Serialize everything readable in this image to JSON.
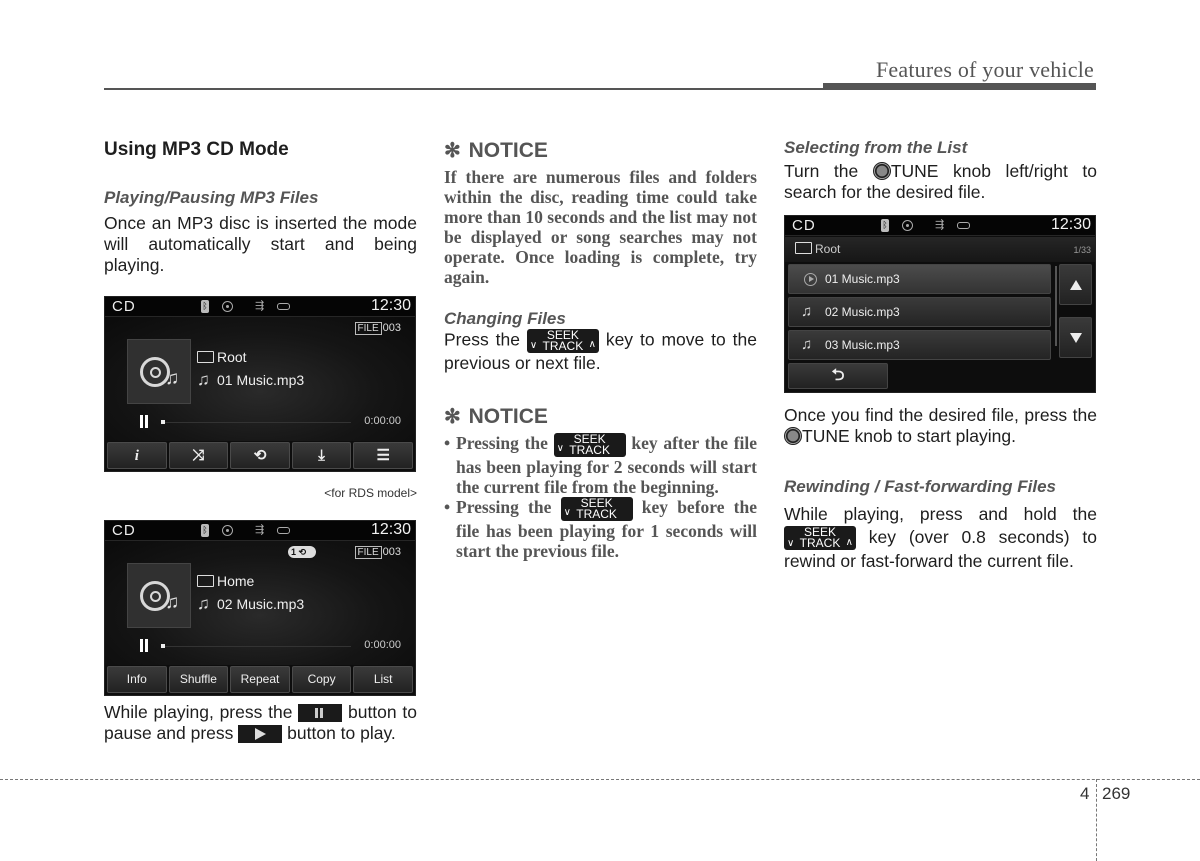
{
  "header": {
    "title": "Features of your vehicle"
  },
  "column1": {
    "section_title": "Using MP3 CD Mode",
    "subhead": "Playing/Pausing MP3 Files",
    "intro": "Once an MP3 disc is inserted the mode will automatically start and being playing.",
    "screen1": {
      "mode": "CD",
      "clock": "12:30",
      "status_icons": [
        "bluetooth-icon",
        "disc-icon",
        "usb-icon",
        "aux-icon"
      ],
      "file_tag": "FILE",
      "file_number": "003",
      "folder": "Root",
      "track": "01 Music.mp3",
      "time": "0:00:00",
      "progress": 0,
      "buttons": [
        {
          "label": "i",
          "icon": "info-icon"
        },
        {
          "label": "⤨",
          "icon": "shuffle-icon"
        },
        {
          "label": "⟲",
          "icon": "repeat-icon"
        },
        {
          "label": "⤓",
          "icon": "copy-icon"
        },
        {
          "label": "☰",
          "icon": "list-icon"
        }
      ]
    },
    "caption": "<for RDS model>",
    "screen2": {
      "mode": "CD",
      "clock": "12:30",
      "repeat_badge": "1",
      "file_tag": "FILE",
      "file_number": "003",
      "folder": "Home",
      "track": "02 Music.mp3",
      "time": "0:00:00",
      "progress": 0,
      "buttons": [
        "Info",
        "Shuffle",
        "Repeat",
        "Copy",
        "List"
      ]
    },
    "pause_text": {
      "part1": "While playing, press the",
      "part2": "button to pause and press",
      "part3": "button to play."
    }
  },
  "column2": {
    "notice1": {
      "heading": "NOTICE",
      "symbol": "✻",
      "text": "If there are numerous files and folders within the disc, reading time could take more than 10 seconds and the list may not be displayed or song searches may not operate. Once loading is complete, try again."
    },
    "changing_files": {
      "subhead": "Changing Files",
      "part1": "Press the",
      "part2": "key to move to the previous or next file."
    },
    "seek_key": {
      "line1": "SEEK",
      "line2": "TRACK"
    },
    "notice2": {
      "heading": "NOTICE",
      "symbol": "✻",
      "bullets": [
        {
          "before": "Pressing the",
          "after": "key after the file has been playing for 2 seconds will start the current file from the beginning."
        },
        {
          "before": "Pressing the",
          "after": "key before the file has been playing for 1 seconds will start the previous file."
        }
      ]
    }
  },
  "column3": {
    "selecting": {
      "subhead": "Selecting from the List",
      "part1": "Turn the",
      "knob_label": "TUNE",
      "part2": "knob left/right to search for the desired file."
    },
    "list_screen": {
      "mode": "CD",
      "clock": "12:30",
      "folder": "Root",
      "count": "1/33",
      "items": [
        {
          "label": "01 Music.mp3",
          "state": "playing"
        },
        {
          "label": "02 Music.mp3",
          "state": ""
        },
        {
          "label": "03 Music.mp3",
          "state": ""
        }
      ],
      "back_symbol": "⮌"
    },
    "found": {
      "part1": "Once you find the desired file, press the",
      "knob_label": "TUNE",
      "part2": "knob to start playing."
    },
    "rewinding": {
      "subhead": "Rewinding / Fast-forwarding Files",
      "part1": "While playing, press and hold the",
      "part2": "key (over 0.8 seconds) to rewind or fast-forward the current file."
    }
  },
  "footer": {
    "chapter": "4",
    "page": "269"
  }
}
